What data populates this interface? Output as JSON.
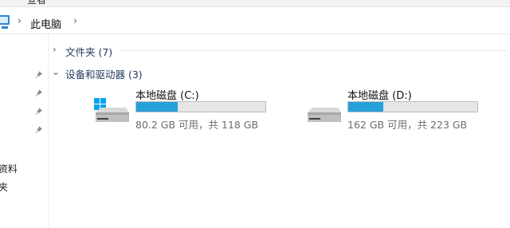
{
  "top_fragment": "查看",
  "address": {
    "current": "此电脑"
  },
  "sidebar": {
    "items": [
      "资料",
      "夹"
    ]
  },
  "groups": [
    {
      "label": "文件夹 (7)",
      "expanded": false
    },
    {
      "label": "设备和驱动器 (3)",
      "expanded": true
    }
  ],
  "drives": [
    {
      "name": "本地磁盘 (C:)",
      "free_text": "80.2 GB 可用，共 118 GB",
      "used_fraction": 0.32,
      "windows_logo": true
    },
    {
      "name": "本地磁盘 (D:)",
      "free_text": "162 GB 可用，共 223 GB",
      "used_fraction": 0.27,
      "windows_logo": false
    }
  ],
  "colors": {
    "bar_fill": "#26a0da",
    "bar_bg": "#e6e6e6",
    "win_blue": "#00a4ef"
  }
}
